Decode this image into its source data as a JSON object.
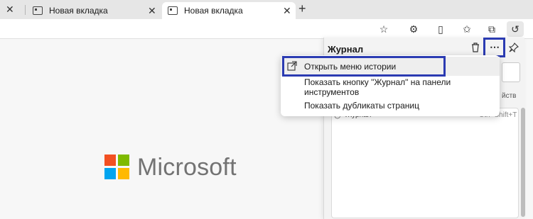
{
  "tabs": [
    {
      "title": "Новая вкладка",
      "active": false
    },
    {
      "title": "Новая вкладка",
      "active": true
    }
  ],
  "new_tab": "+",
  "toolbar": {
    "icons": [
      "favorite-star-icon",
      "extensions-icon",
      "split-screen-icon",
      "favorites-icon",
      "collections-icon",
      "history-icon"
    ]
  },
  "content": {
    "logo_text": "Microsoft",
    "logo_colors": [
      "#f25022",
      "#7fba00",
      "#00a4ef",
      "#ffb900"
    ]
  },
  "history_panel": {
    "title": "Журнал",
    "entry_label": "Журнал",
    "entry_shortcut": "Ctrl+Shift+T",
    "peek_text": "йств"
  },
  "menu": {
    "items": [
      {
        "label": "Открыть меню истории"
      },
      {
        "label": "Показать кнопку \"Журнал\" на панели инструментов"
      },
      {
        "label": "Показать дубликаты страниц"
      }
    ]
  },
  "colors": {
    "highlight": "#2b3bb2"
  }
}
